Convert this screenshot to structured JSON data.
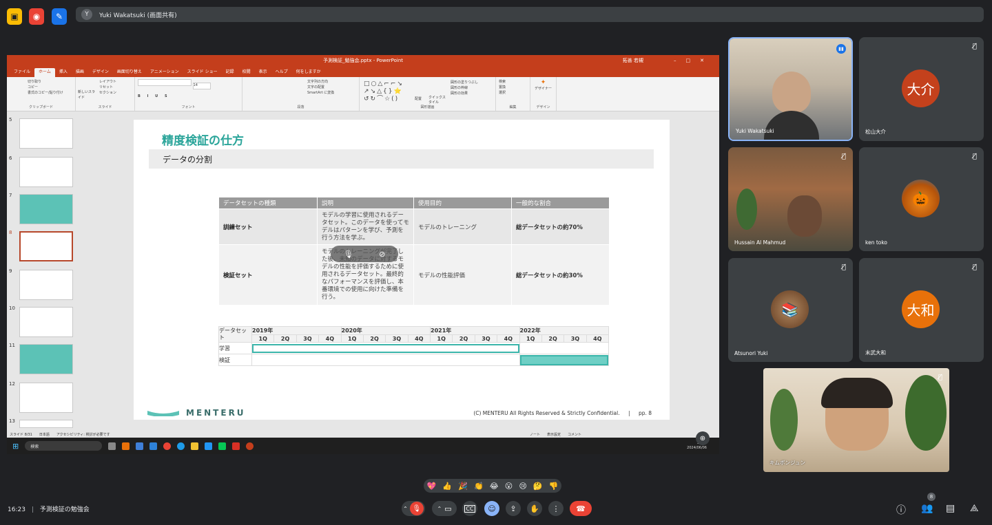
{
  "meet": {
    "presenter_banner": "Yuki Wakatsuki (画面共有)",
    "presenter_initial": "Y",
    "time": "16:23",
    "meeting_title": "予測検証の勉強会",
    "participant_count": "8"
  },
  "ppt": {
    "title": "予測検証_勉強会.pptx - PowerPoint",
    "user": "拓善 若槻",
    "tabs": [
      "ファイル",
      "ホーム",
      "挿入",
      "描画",
      "デザイン",
      "画面切り替え",
      "アニメーション",
      "スライド ショー",
      "記録",
      "校閲",
      "表示",
      "ヘルプ",
      "何をしますか"
    ],
    "ribbon": {
      "clipboard": [
        "切り取り",
        "コピー",
        "書式のコピー/貼り付け"
      ],
      "clipboard_label": "クリップボード",
      "slide_items": [
        "レイアウト",
        "リセット",
        "セクション"
      ],
      "new_slide": "新しいスライド",
      "slide_label": "スライド",
      "font_label": "フォント",
      "font_size": "14",
      "paragraph_items": [
        "文字列の方向",
        "文字の配置",
        "SmartArt に変換"
      ],
      "paragraph_label": "段落",
      "arrange": "配置",
      "quick_style": "クイックスタイル",
      "shape_items": [
        "図形の塗りつぶし",
        "図形の枠線",
        "図形の効果"
      ],
      "drawing_label": "図形描画",
      "edit_items": [
        "検索",
        "置換",
        "選択"
      ],
      "edit_label": "編集",
      "designer": "デザイナー",
      "designer_label": "デザイン"
    },
    "thumb_numbers": [
      "5",
      "6",
      "7",
      "8",
      "9",
      "10",
      "11",
      "12",
      "13"
    ],
    "status": {
      "slide": "スライド 8/31",
      "lang": "日本語",
      "accessibility": "アクセシビリティ: 検討が必要です",
      "notes": "ノート",
      "display": "表示設定",
      "comments": "コメント"
    },
    "taskbar_search": "検索",
    "clock_time": "16:23",
    "clock_date": "2024/06/06"
  },
  "slide": {
    "title": "精度検証の仕方",
    "subtitle": "データの分割",
    "table": {
      "headers": [
        "データセットの種類",
        "説明",
        "使用目的",
        "一般的な割合"
      ],
      "rows": [
        {
          "type": "訓練セット",
          "desc": "モデルの学習に使用されるデータセット。このデータを使ってモデルはパターンを学び、予測を行う方法を学ぶ。",
          "purpose": "モデルのトレーニング",
          "ratio": "総データセットの約70%"
        },
        {
          "type": "検証セット",
          "desc": "モデルのトレーニングが完了した後、未知のデータに対するモデルの性能を評価するために使用されるデータセット。最終的なパフォーマンスを評価し、本番環境での使用に向けた準備を行う。",
          "purpose": "モデルの性能評価",
          "ratio": "総データセットの約30%"
        }
      ]
    },
    "gantt": {
      "header": "データセット",
      "years": [
        "2019年",
        "2020年",
        "2021年",
        "2022年"
      ],
      "quarters": [
        "1Q",
        "2Q",
        "3Q",
        "4Q",
        "1Q",
        "2Q",
        "3Q",
        "4Q",
        "1Q",
        "2Q",
        "3Q",
        "4Q",
        "1Q",
        "2Q",
        "3Q",
        "4Q"
      ],
      "rows": [
        "学習",
        "検証"
      ]
    },
    "logo": "MENTERU",
    "copyright": "(C) MENTERU All Rights Reserved & Strictly Confidential.",
    "page": "pp. 8"
  },
  "participants": [
    {
      "name": "Yuki Wakatsuki",
      "type": "video"
    },
    {
      "name": "松山大介",
      "avatar": "大介",
      "color": "#c4411c"
    },
    {
      "name": "Hussain Al Mahmud",
      "type": "video"
    },
    {
      "name": "ken toko",
      "type": "image"
    },
    {
      "name": "Atsunori Yuki",
      "type": "image"
    },
    {
      "name": "末武大和",
      "avatar": "大和",
      "color": "#e8710a"
    },
    {
      "name": "キムボンジュン",
      "type": "video"
    }
  ],
  "reactions": [
    "💖",
    "👍",
    "🎉",
    "👏",
    "😂",
    "😮",
    "😢",
    "🤔",
    "👎"
  ]
}
